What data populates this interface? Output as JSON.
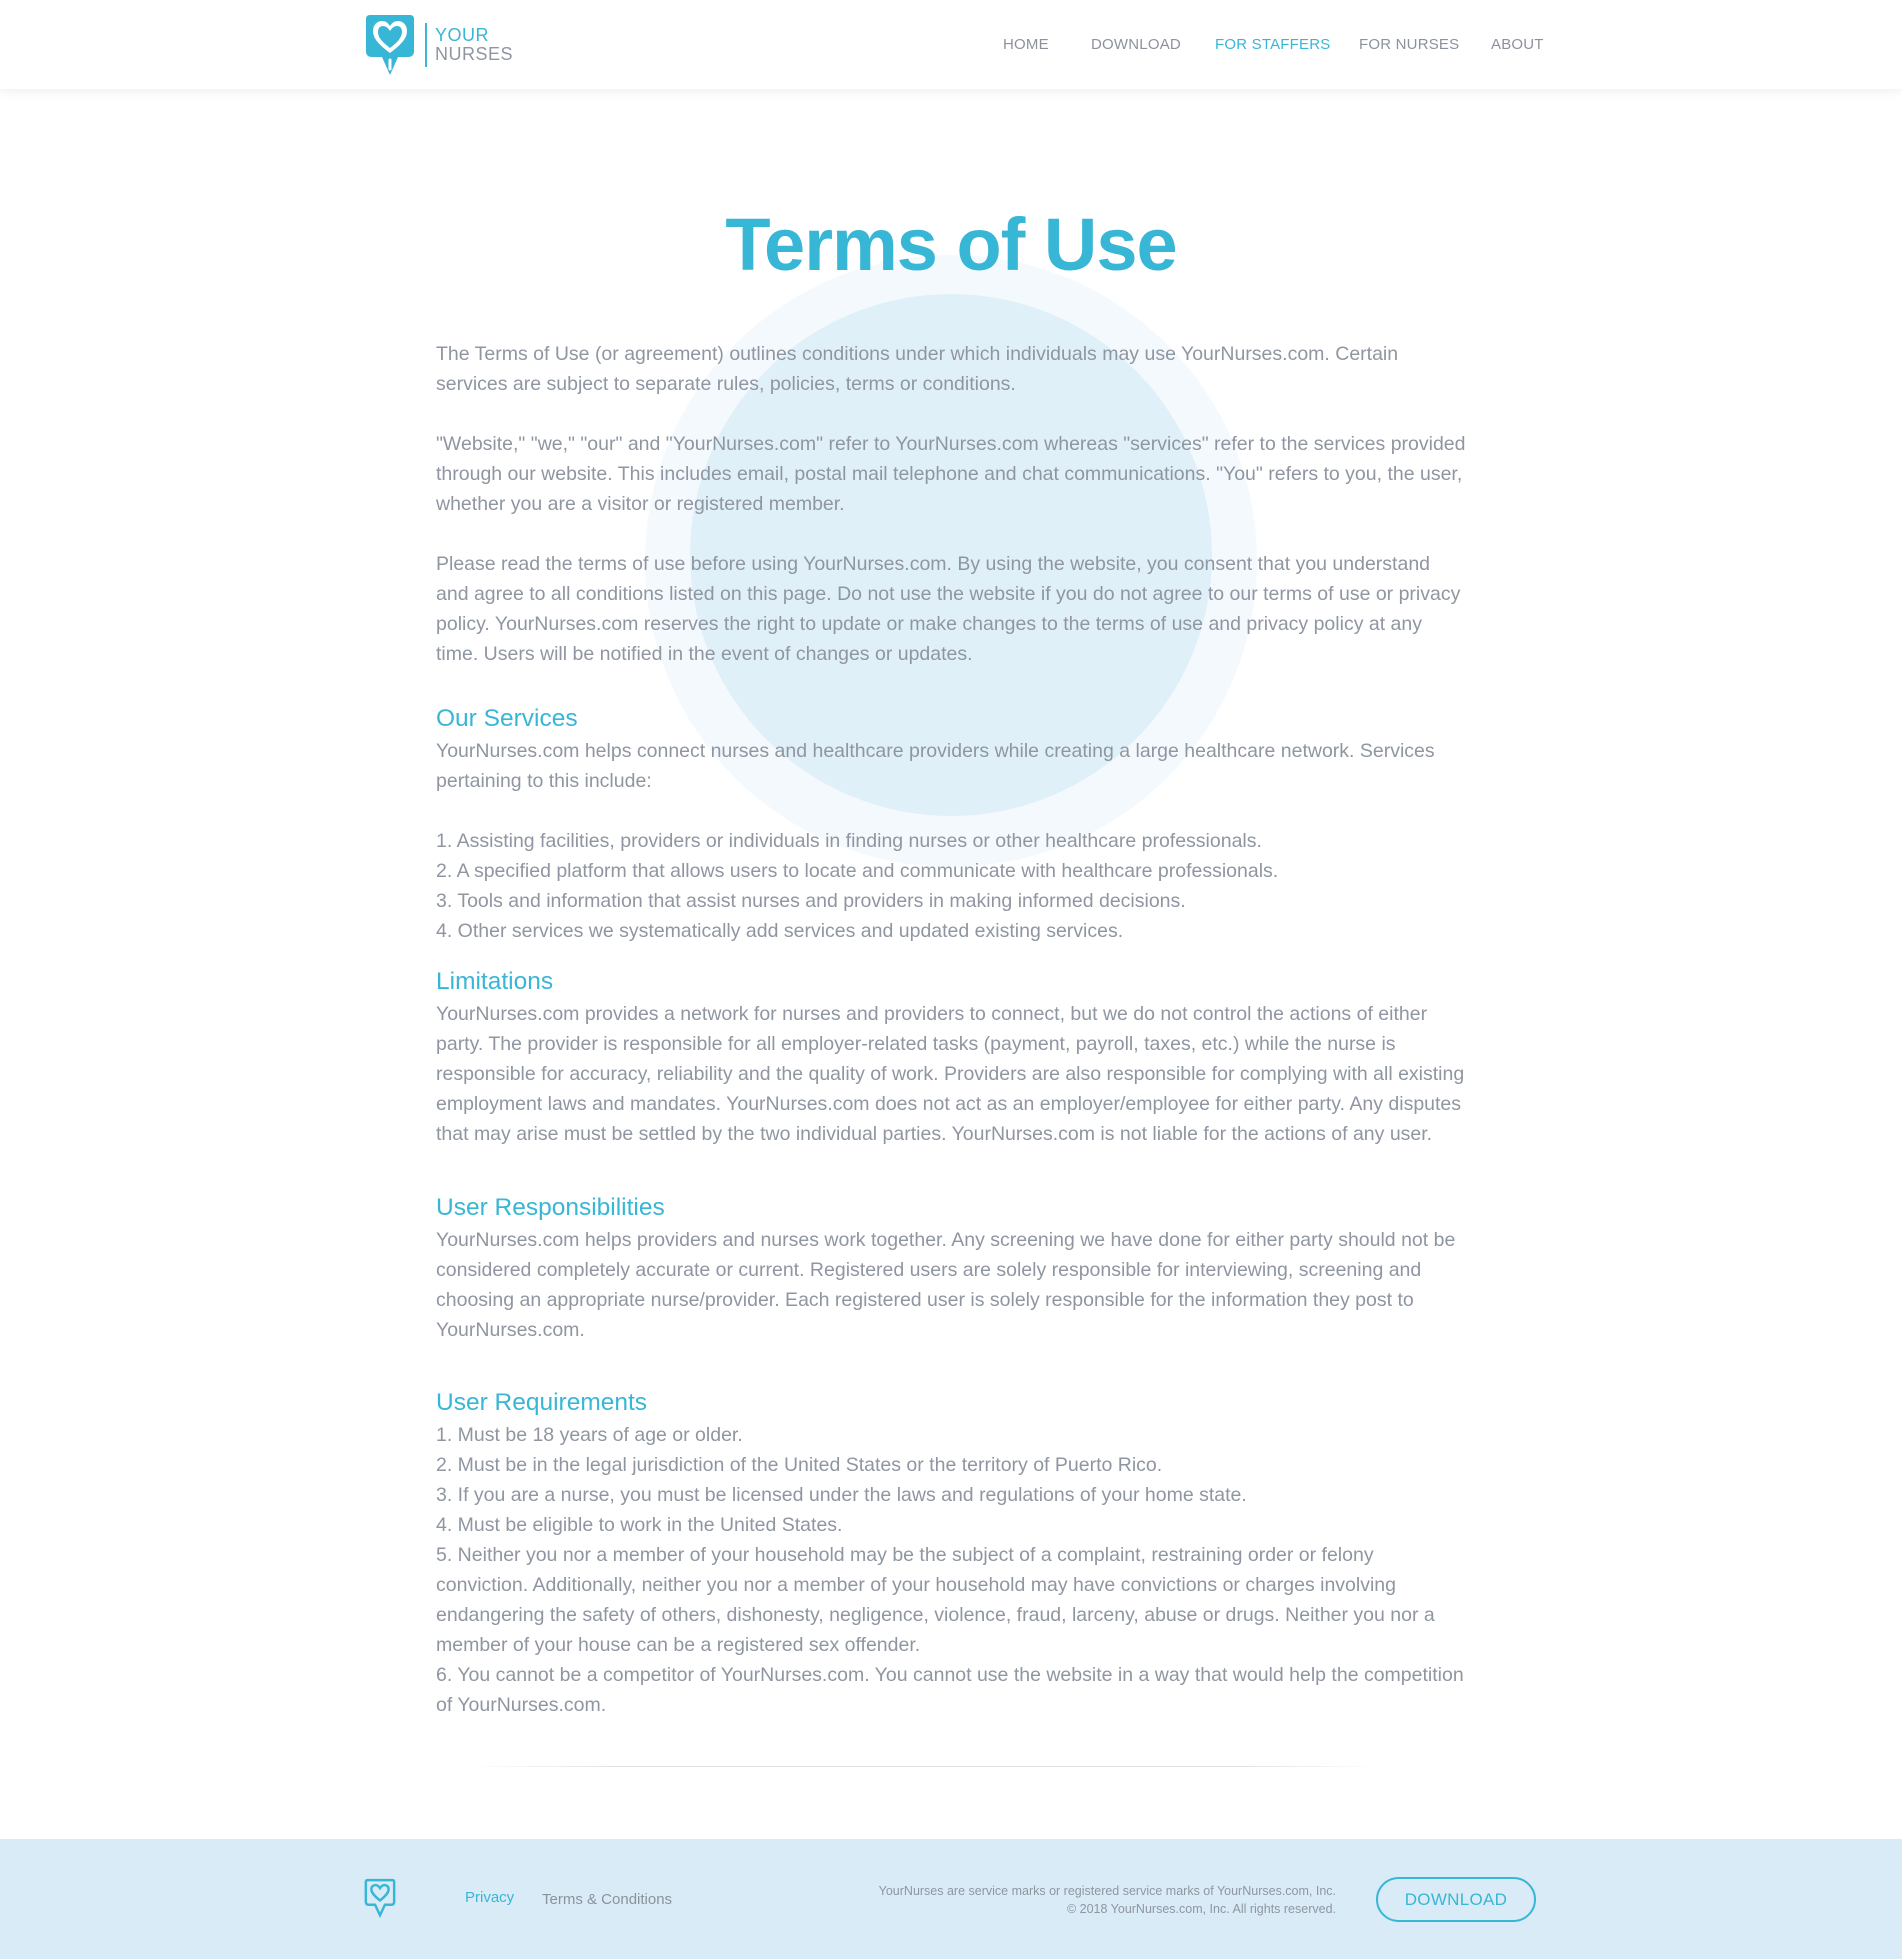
{
  "header": {
    "logo": {
      "line1": "YOUR",
      "line2": "NURSES"
    },
    "nav": [
      {
        "label": "HOME",
        "active": false
      },
      {
        "label": "DOWNLOAD",
        "active": false
      },
      {
        "label": "FOR STAFFERS",
        "active": true
      },
      {
        "label": "FOR NURSES",
        "active": false
      },
      {
        "label": "ABOUT",
        "active": false
      }
    ]
  },
  "main": {
    "title": "Terms of Use",
    "intro": [
      "The Terms of Use (or agreement) outlines conditions under which individuals may use YourNurses.com. Certain services are subject to separate rules, policies, terms or conditions.",
      "\"Website,\" \"we,\" \"our\" and \"YourNurses.com\" refer to YourNurses.com whereas \"services\" refer to the services provided through our website. This includes email, postal mail telephone and chat communications. \"You\" refers to you, the user, whether you are a visitor or registered member.",
      "Please read the terms of use before using YourNurses.com. By using the website, you consent that you understand and agree to all conditions listed on this page. Do not use the website if you do not agree to our terms of use or privacy policy. YourNurses.com reserves the right to update or make changes to the terms of use and privacy policy at any time. Users will be notified in the event of changes or updates."
    ],
    "our_services": {
      "heading": "Our Services",
      "text": "YourNurses.com helps connect nurses and healthcare providers while creating a large healthcare network. Services pertaining to this include:",
      "items": [
        "1. Assisting facilities, providers or individuals in finding nurses or other healthcare professionals.",
        "2. A specified platform that allows users to locate and communicate with healthcare professionals.",
        "3. Tools and information that assist nurses and providers in making informed decisions.",
        "4. Other services we systematically add services and updated existing services."
      ]
    },
    "limitations": {
      "heading": "Limitations",
      "text": "YourNurses.com provides a network for nurses and providers to connect, but we do not control the actions of either party. The provider is responsible for all employer-related tasks (payment, payroll, taxes, etc.) while the nurse is responsible for accuracy, reli­ability and the quality of work. Providers are also responsible for complying with all existing employment laws and mandates. Your­Nurses.com does not act as an employer/employee for either party. Any disputes that may arise must be settled by the two individual parties. YourNurses.com is not liable for the actions of any user."
    },
    "user_responsibilities": {
      "heading": "User Responsibilities",
      "text": "YourNurses.com helps providers and nurses work together. Any screening we have done for either party should not be considered completely accurate or current. Registered users are solely responsible for interviewing, screening and choosing an appropriate nurse/provider. Each registered user is solely responsible for the information they post to YourNurses.com."
    },
    "user_requirements": {
      "heading": "User Requirements",
      "items": [
        "1. Must be 18 years of age or older.",
        "2. Must be in the legal jurisdiction of the United States or the territory of Puerto Rico.",
        "3. If you are a nurse, you must be licensed under the laws and regulations of your home state.",
        "4. Must be eligible to work in the United States.",
        "5. Neither you nor a member of your household may be the subject of a complaint, restraining order or felony conviction. Addition­ally, neither you nor a member of your household may have convictions or charges involving endangering the safety of others, dis­honesty, negligence, violence, fraud, larceny, abuse or drugs. Neither you nor a member of your house can be a registered sex offender.",
        "6. You cannot be a competitor of YourNurses.com. You cannot use the website in a way that would help the competition of Your­Nurses.com."
      ]
    }
  },
  "footer": {
    "links": {
      "privacy": "Privacy",
      "terms": "Terms & Conditions"
    },
    "legal_line1": "YourNurses are service marks or registered service marks of YourNurses.com, Inc.",
    "legal_line2": "© 2018 YourNurses.com, Inc. All rights reserved.",
    "download_label": "DOWNLOAD"
  },
  "colors": {
    "accent": "#38b6d6",
    "text": "#8f96a1",
    "footer_bg": "#d8ebf6",
    "circle_light": "#f3f9fd",
    "circle_mid": "#e0f0f9"
  },
  "icons": {
    "logo": "nurse-heart-pin-logo-icon"
  }
}
